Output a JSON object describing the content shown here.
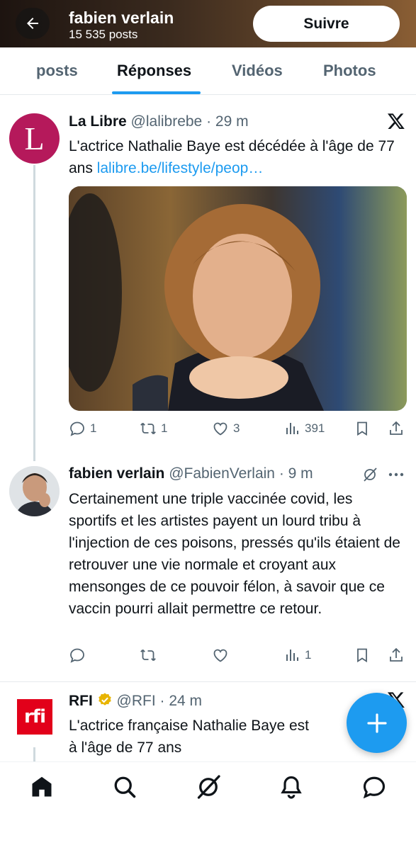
{
  "header": {
    "name": "fabien verlain",
    "post_count": "15 535 posts",
    "follow_label": "Suivre"
  },
  "tabs": [
    {
      "label": "posts",
      "active": false
    },
    {
      "label": "Réponses",
      "active": true
    },
    {
      "label": "Vidéos",
      "active": false
    },
    {
      "label": "Photos",
      "active": false
    }
  ],
  "tweets": [
    {
      "name": "La Libre",
      "handle": "@lalibrebe",
      "time": "· 29 m",
      "avatar_letter": "L",
      "text": "L'actrice Nathalie Baye est décédée à l'âge de 77 ans ",
      "link": "lalibre.be/lifestyle/peop…",
      "stats": {
        "replies": "1",
        "reposts": "1",
        "likes": "3",
        "views": "391"
      }
    },
    {
      "name": "fabien verlain",
      "handle": "@FabienVerlain",
      "time": "· 9 m",
      "text": "Certainement une triple vaccinée covid, les sportifs et les artistes payent un lourd tribu à l'injection de ces poisons, pressés qu'ils étaient de retrouver une vie normale et croyant aux mensonges de ce pouvoir félon, à savoir que ce vaccin pourri allait permettre ce retour.",
      "stats": {
        "replies": "",
        "reposts": "",
        "likes": "",
        "views": "1"
      }
    },
    {
      "name": "RFI",
      "handle": "@RFI",
      "time": "· 24 m",
      "avatar_text": "rfi",
      "text": "L'actrice française Nathalie Baye est",
      "text2": "à l'âge de 77 ans"
    }
  ],
  "colors": {
    "accent": "#1d9bf0",
    "secondary_text": "#536471",
    "lalibre": "#b5195b",
    "rfi": "#e2001a",
    "verified": "#e8b400"
  },
  "icons": [
    "back-arrow-icon",
    "x-logo-icon",
    "reply-icon",
    "repost-icon",
    "like-icon",
    "views-icon",
    "bookmark-icon",
    "share-icon",
    "grok-icon",
    "more-icon",
    "verified-badge-icon",
    "compose-icon",
    "home-icon",
    "search-icon",
    "notifications-icon",
    "messages-icon"
  ]
}
